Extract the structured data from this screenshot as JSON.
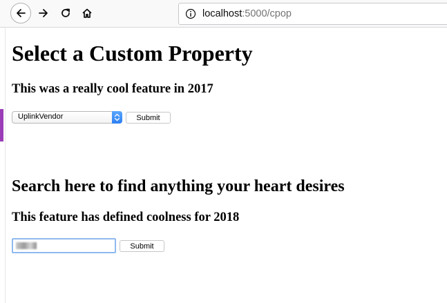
{
  "browser": {
    "url_host": "localhost",
    "url_rest": ":5000/cpop",
    "icons": {
      "back": "back-arrow-icon",
      "forward": "forward-arrow-icon",
      "reload": "reload-icon",
      "home": "home-icon",
      "info": "info-icon"
    }
  },
  "section1": {
    "title": "Select a Custom Property",
    "subtitle": "This was a really cool feature in 2017",
    "select_value": "UplinkVendor",
    "submit_label": "Submit"
  },
  "section2": {
    "title": "Search here to find anything your heart desires",
    "subtitle": "This feature has defined coolness for 2018",
    "search_value": "",
    "submit_label": "Submit"
  },
  "colors": {
    "accent": "#9a3db7",
    "select_arrow": "#2c7ff0",
    "focus": "#8fb9ef"
  }
}
